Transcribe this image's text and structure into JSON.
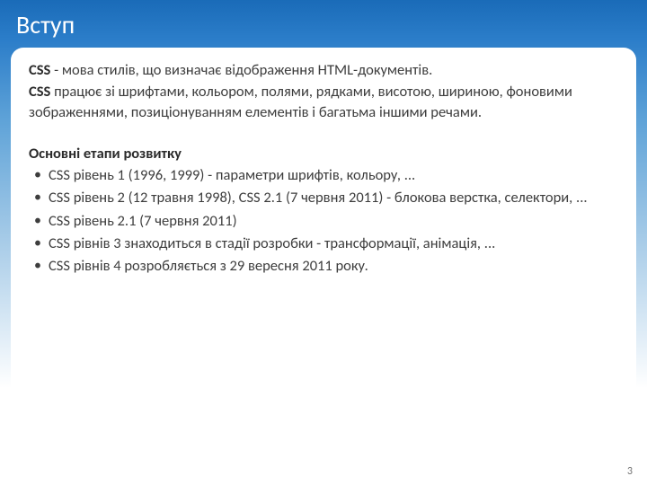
{
  "title": "Вступ",
  "para1_bold": "CSS",
  "para1_rest": " - мова стилів, що визначає відображення HTML-документів.",
  "para2_bold": "CSS",
  "para2_rest": " працює зі шрифтами, кольором, полями, рядками, висотою, шириною, фоновими зображеннями, позиціонуванням елементів і багатьма іншими речами.",
  "subheading": "Основні етапи розвитку",
  "bullets": [
    "CSS рівень 1 (1996, 1999) - параметри шрифтів, кольору, ...",
    "CSS рівень 2 (12 травня 1998), CSS 2.1 (7 червня 2011) - блокова верстка, селектори, ...",
    "CSS рівень 2.1 (7 червня 2011)",
    "CSS рівнів 3 знаходиться в стадії розробки - трансформації, анімація, ...",
    "CSS рівнів 4 розробляється з 29 вересня 2011 року."
  ],
  "page_number": "3"
}
